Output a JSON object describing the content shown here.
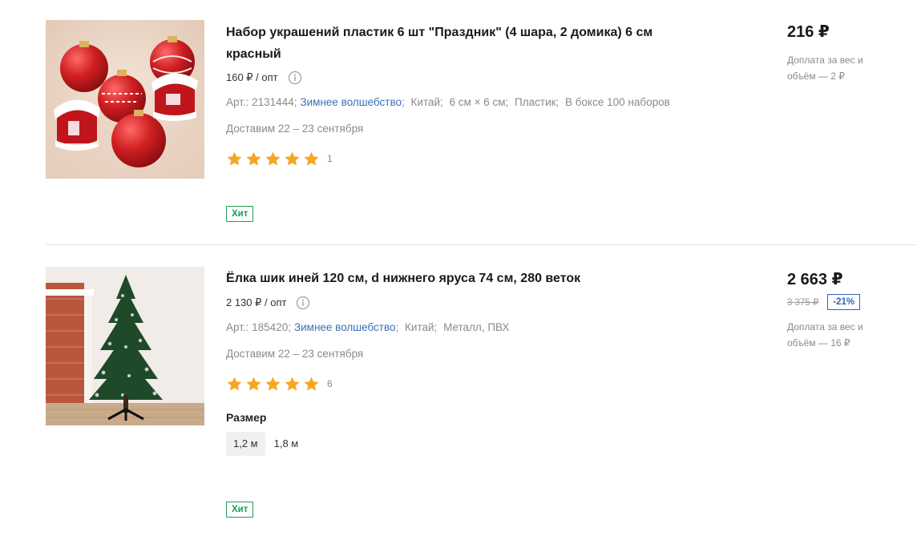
{
  "products": [
    {
      "title": "Набор украшений пластик 6 шт \"Праздник\" (4 шара, 2 домика) 6 см красный",
      "opt_price": "160 ₽ / опт",
      "attributes": {
        "art": "Арт.: 2131444;",
        "brand": "Зимнее волшебство",
        "country": "Китай;",
        "dims": "6 см × 6 см;",
        "material": "Пластик;",
        "box": "В боксе 100 наборов"
      },
      "delivery": "Доставим 22 – 23 сентября",
      "rating": 5,
      "reviews_count": "1",
      "badge": "Хит",
      "price": "216 ₽",
      "surcharge": "Доплата за вес и объём — 2 ₽"
    },
    {
      "title": "Ёлка шик иней 120 см, d нижнего яруса 74 см, 280 веток",
      "opt_price": "2 130 ₽ / опт",
      "attributes": {
        "art": "Арт.: 185420;",
        "brand": "Зимнее волшебство",
        "country": "Китай;",
        "material": "Металл, ПВХ"
      },
      "delivery": "Доставим 22 – 23 сентября",
      "rating": 5,
      "reviews_count": "6",
      "size_label": "Размер",
      "sizes": [
        "1,2 м",
        "1,8 м"
      ],
      "selected_size": "1,2 м",
      "badge": "Хит",
      "price": "2 663 ₽",
      "old_price": "3 375 ₽",
      "discount": "-21%",
      "surcharge": "Доплата за вес и объём — 16 ₽"
    }
  ],
  "colors": {
    "star": "#f5a623",
    "hit_badge": "#1f9d55",
    "discount_badge": "#2f64b5",
    "link": "#3a6fb7"
  },
  "icons": {
    "info": "info-icon",
    "star": "star-icon"
  }
}
